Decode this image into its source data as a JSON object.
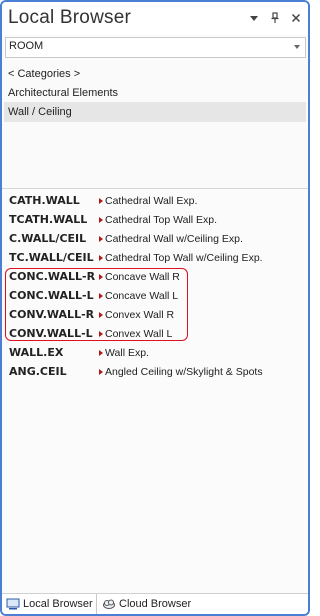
{
  "window": {
    "title": "Local Browser",
    "controls": {
      "menu_icon": "dropdown-arrow",
      "pin_icon": "pin",
      "close_icon": "close-x"
    }
  },
  "library_select": {
    "value": "ROOM"
  },
  "categories": [
    {
      "label": "< Categories >",
      "selected": false
    },
    {
      "label": "Architectural Elements",
      "selected": false
    },
    {
      "label": "Wall / Ceiling",
      "selected": true
    }
  ],
  "items": [
    {
      "code": "CATH.WALL",
      "description": "Cathedral Wall Exp."
    },
    {
      "code": "TCATH.WALL",
      "description": "Cathedral Top Wall Exp."
    },
    {
      "code": "C.WALL/CEIL",
      "description": "Cathedral Wall w/Ceiling Exp."
    },
    {
      "code": "TC.WALL/CEIL",
      "description": "Cathedral Top Wall w/Ceiling Exp."
    },
    {
      "code": "CONC.WALL-R",
      "description": "Concave Wall R"
    },
    {
      "code": "CONC.WALL-L",
      "description": "Concave Wall L"
    },
    {
      "code": "CONV.WALL-R",
      "description": "Convex Wall R"
    },
    {
      "code": "CONV.WALL-L",
      "description": "Convex Wall L"
    },
    {
      "code": "WALL.EX",
      "description": "Wall Exp."
    },
    {
      "code": "ANG.CEIL",
      "description": "Angled Ceiling w/Skylight & Spots"
    }
  ],
  "tabs": [
    {
      "label": "Local Browser",
      "active": true
    },
    {
      "label": "Cloud Browser",
      "active": false
    }
  ],
  "colors": {
    "accent_border": "#4a7fd4",
    "item_arrow": "#b01818",
    "highlight_outline": "#e01020",
    "selected_bg": "#e6e6e6"
  }
}
